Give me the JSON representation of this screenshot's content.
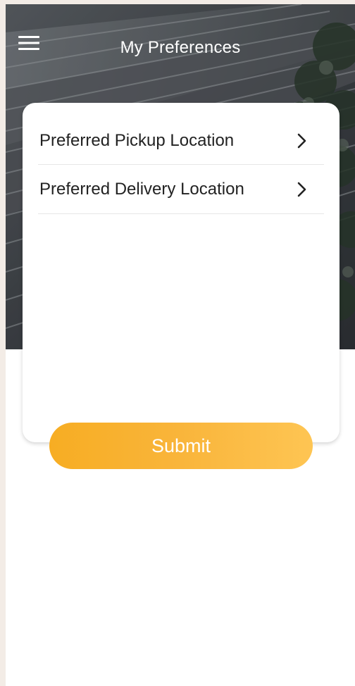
{
  "header": {
    "title": "My Preferences",
    "menu_icon": "hamburger-menu-icon"
  },
  "preferences": {
    "items": [
      {
        "label": "Preferred Pickup Location",
        "icon": "chevron-right-icon"
      },
      {
        "label": "Preferred Delivery Location",
        "icon": "chevron-right-icon"
      }
    ]
  },
  "actions": {
    "submit_label": "Submit"
  },
  "colors": {
    "accent": "#f9b53b",
    "page_background": "#f3ece6",
    "card_background": "#ffffff",
    "text_primary": "#222222"
  }
}
